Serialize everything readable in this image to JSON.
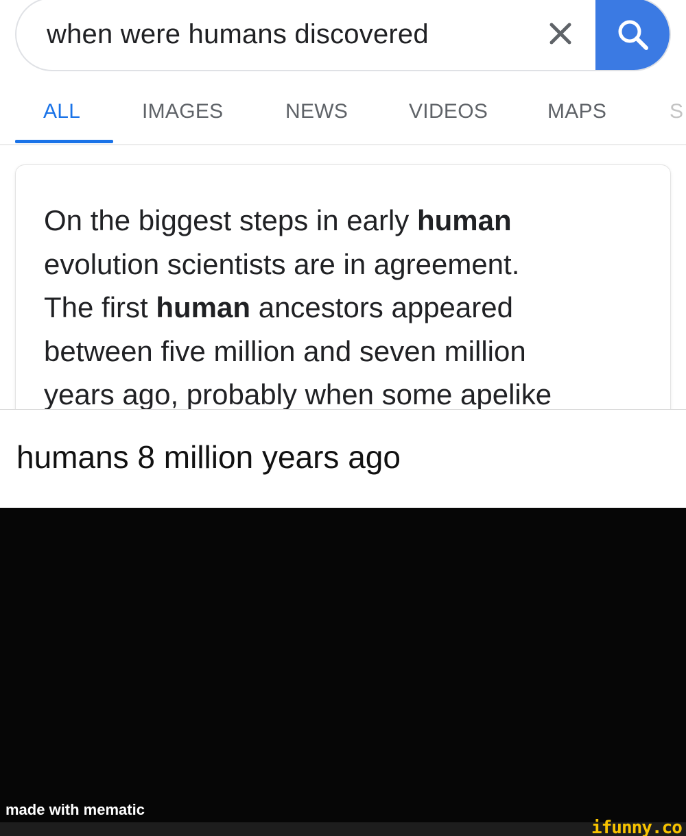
{
  "search": {
    "query": "when were humans discovered"
  },
  "tabs": [
    {
      "label": "ALL",
      "active": true
    },
    {
      "label": "IMAGES",
      "active": false
    },
    {
      "label": "NEWS",
      "active": false
    },
    {
      "label": "VIDEOS",
      "active": false
    },
    {
      "label": "MAPS",
      "active": false
    },
    {
      "label": "S",
      "active": false
    }
  ],
  "answer": {
    "line1_a": "On the biggest steps in early ",
    "line1_b": "human",
    "line2": "evolution scientists are in agreement.",
    "line3_a": "The first ",
    "line3_b": "human",
    "line3_c": " ancestors appeared",
    "line4": "between five million and seven million",
    "line5": "years ago, probably when some apelike"
  },
  "caption": "humans 8 million years ago",
  "watermarks": {
    "made_with": "made with mematic",
    "site": "ifunny.co"
  },
  "colors": {
    "accent": "#1a73e8",
    "search_button": "#3b7ae3",
    "logo": "#f7c300"
  }
}
